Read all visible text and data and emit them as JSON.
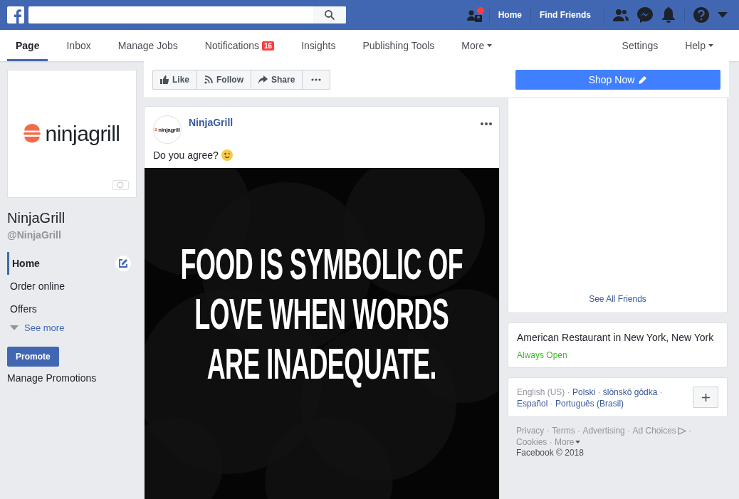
{
  "top_bar": {
    "nav": [
      {
        "label": "Home"
      },
      {
        "label": "Find Friends"
      }
    ],
    "requests_alert": true
  },
  "page_tabs": [
    {
      "label": "Page",
      "selected": true
    },
    {
      "label": "Inbox",
      "selected": false
    },
    {
      "label": "Manage Jobs",
      "selected": false
    },
    {
      "label": "Notifications",
      "selected": false,
      "badge": "16"
    },
    {
      "label": "Insights",
      "selected": false
    },
    {
      "label": "Publishing Tools",
      "selected": false
    },
    {
      "label": "More",
      "selected": false,
      "dropdown": true
    }
  ],
  "page_tabs_right": [
    {
      "label": "Settings",
      "dropdown": false
    },
    {
      "label": "Help",
      "dropdown": true
    }
  ],
  "sidebar": {
    "logo_text": "ninjagrill",
    "name": "NinjaGrill",
    "handle": "@NinjaGrill",
    "items": [
      {
        "label": "Home",
        "selected": true
      },
      {
        "label": "Order online",
        "selected": false
      },
      {
        "label": "Offers",
        "selected": false
      }
    ],
    "see_more": "See more",
    "promote_button": "Promote",
    "manage_link": "Manage Promotions"
  },
  "actions": [
    {
      "kind": "like",
      "label": "Like"
    },
    {
      "kind": "follow",
      "label": "Follow"
    },
    {
      "kind": "share",
      "label": "Share"
    },
    {
      "kind": "more"
    }
  ],
  "shop_button": "Shop Now",
  "post": {
    "author": "NinjaGrill",
    "avatar_text": "ninjagrill",
    "text": "Do you agree?",
    "image_lines": [
      "FOOD IS SYMBOLIC OF",
      "LOVE WHEN WORDS",
      "ARE INADEQUATE."
    ]
  },
  "friends_card": {
    "link": "See All Friends"
  },
  "about_card": {
    "category": "American Restaurant in New York, New York",
    "hours": "Always Open"
  },
  "languages": [
    {
      "label": "English (US)",
      "selected": true,
      "sep": "·"
    },
    {
      "label": "Polski",
      "selected": false,
      "sep": "·"
    },
    {
      "label": "ślōnskŏ gŏdka",
      "selected": false,
      "sep": "·"
    },
    {
      "label": "Español",
      "selected": false,
      "sep": "·"
    },
    {
      "label": "Português (Brasil)",
      "selected": false
    }
  ],
  "footer_links": [
    {
      "label": "Privacy",
      "sep": "·"
    },
    {
      "label": "Terms",
      "sep": "·"
    },
    {
      "label": "Advertising",
      "sep": "·"
    },
    {
      "label": "Ad Choices",
      "kind": "adchoices",
      "sep": "·"
    },
    {
      "label": "Cookies",
      "sep": "·"
    },
    {
      "label": "More",
      "kind": "dropdown"
    }
  ],
  "copyright": "Facebook © 2018"
}
